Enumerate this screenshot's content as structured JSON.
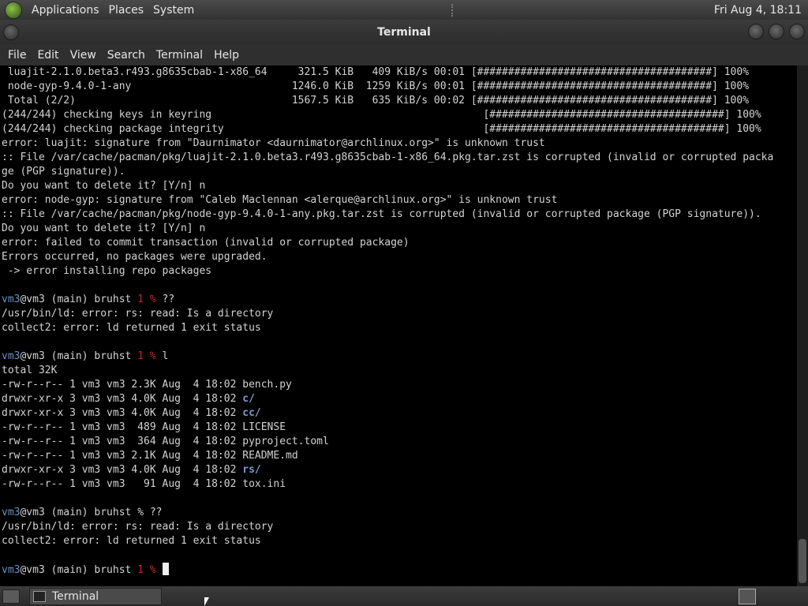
{
  "top_panel": {
    "menus": [
      "Applications",
      "Places",
      "System"
    ],
    "clock": "Fri Aug  4, 18:11"
  },
  "window": {
    "title": "Terminal"
  },
  "menubar": [
    "File",
    "Edit",
    "View",
    "Search",
    "Terminal",
    "Help"
  ],
  "terminal_lines": [
    [
      {
        "t": " luajit-2.1.0.beta3.r493.g8635cbab-1-x86_64     321.5 KiB   409 KiB/s 00:01 [######################################] 100%"
      }
    ],
    [
      {
        "t": " node-gyp-9.4.0-1-any                          1246.0 KiB  1259 KiB/s 00:01 [######################################] 100%"
      }
    ],
    [
      {
        "t": " Total (2/2)                                   1567.5 KiB   635 KiB/s 00:02 [######################################] 100%"
      }
    ],
    [
      {
        "t": "(244/244) checking keys in keyring                                            [######################################] 100%"
      }
    ],
    [
      {
        "t": "(244/244) checking package integrity                                          [######################################] 100%"
      }
    ],
    [
      {
        "t": "error: luajit: signature from \"Daurnimator <daurnimator@archlinux.org>\" is unknown trust"
      }
    ],
    [
      {
        "t": ":: File /var/cache/pacman/pkg/luajit-2.1.0.beta3.r493.g8635cbab-1-x86_64.pkg.tar.zst is corrupted (invalid or corrupted packa"
      }
    ],
    [
      {
        "t": "ge (PGP signature))."
      }
    ],
    [
      {
        "t": "Do you want to delete it? [Y/n] n"
      }
    ],
    [
      {
        "t": "error: node-gyp: signature from \"Caleb Maclennan <alerque@archlinux.org>\" is unknown trust"
      }
    ],
    [
      {
        "t": ":: File /var/cache/pacman/pkg/node-gyp-9.4.0-1-any.pkg.tar.zst is corrupted (invalid or corrupted package (PGP signature))."
      }
    ],
    [
      {
        "t": "Do you want to delete it? [Y/n] n"
      }
    ],
    [
      {
        "t": "error: failed to commit transaction (invalid or corrupted package)"
      }
    ],
    [
      {
        "t": "Errors occurred, no packages were upgraded."
      }
    ],
    [
      {
        "t": " -> error installing repo packages"
      }
    ],
    [
      {
        "t": ""
      }
    ],
    [
      {
        "t": "vm3",
        "c": "user"
      },
      {
        "t": "@vm3 (main) bruhst "
      },
      {
        "t": "1 %",
        "c": "red"
      },
      {
        "t": " ??"
      }
    ],
    [
      {
        "t": "/usr/bin/ld: error: rs: read: Is a directory"
      }
    ],
    [
      {
        "t": "collect2: error: ld returned 1 exit status"
      }
    ],
    [
      {
        "t": ""
      }
    ],
    [
      {
        "t": "vm3",
        "c": "user"
      },
      {
        "t": "@vm3 (main) bruhst "
      },
      {
        "t": "1 %",
        "c": "red"
      },
      {
        "t": " l"
      }
    ],
    [
      {
        "t": "total 32K"
      }
    ],
    [
      {
        "t": "-rw-r--r-- 1 vm3 vm3 2.3K Aug  4 18:02 bench.py"
      }
    ],
    [
      {
        "t": "drwxr-xr-x 3 vm3 vm3 4.0K Aug  4 18:02 "
      },
      {
        "t": "c/",
        "c": "dir"
      }
    ],
    [
      {
        "t": "drwxr-xr-x 3 vm3 vm3 4.0K Aug  4 18:02 "
      },
      {
        "t": "cc/",
        "c": "dir"
      }
    ],
    [
      {
        "t": "-rw-r--r-- 1 vm3 vm3  489 Aug  4 18:02 LICENSE"
      }
    ],
    [
      {
        "t": "-rw-r--r-- 1 vm3 vm3  364 Aug  4 18:02 pyproject.toml"
      }
    ],
    [
      {
        "t": "-rw-r--r-- 1 vm3 vm3 2.1K Aug  4 18:02 README.md"
      }
    ],
    [
      {
        "t": "drwxr-xr-x 3 vm3 vm3 4.0K Aug  4 18:02 "
      },
      {
        "t": "rs/",
        "c": "dir"
      }
    ],
    [
      {
        "t": "-rw-r--r-- 1 vm3 vm3   91 Aug  4 18:02 tox.ini"
      }
    ],
    [
      {
        "t": ""
      }
    ],
    [
      {
        "t": "vm3",
        "c": "user"
      },
      {
        "t": "@vm3 (main) bruhst % ??"
      }
    ],
    [
      {
        "t": "/usr/bin/ld: error: rs: read: Is a directory"
      }
    ],
    [
      {
        "t": "collect2: error: ld returned 1 exit status"
      }
    ],
    [
      {
        "t": ""
      }
    ],
    [
      {
        "t": "vm3",
        "c": "user"
      },
      {
        "t": "@vm3 (main) bruhst "
      },
      {
        "t": "1 %",
        "c": "red"
      },
      {
        "t": " "
      },
      {
        "cursor": true
      }
    ]
  ],
  "taskbar": {
    "task_label": "Terminal"
  },
  "colors": {
    "user": "#6b8fc2",
    "error_code": "#c12b2b",
    "directory": "#7c9ccc",
    "text": "#d3d3d3",
    "background": "#000000"
  },
  "icons": {
    "logo": "gnome-foot-icon",
    "show_desktop": "show-desktop-icon",
    "task": "terminal-icon",
    "workspace": "workspace-switcher-icon"
  }
}
